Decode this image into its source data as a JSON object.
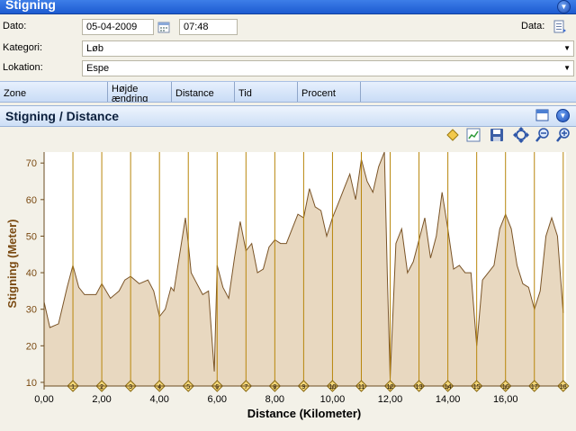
{
  "window": {
    "title": "Stigning"
  },
  "form": {
    "date_label": "Dato:",
    "date_value": "05-04-2009",
    "time_value": "07:48",
    "data_label": "Data:",
    "category_label": "Kategori:",
    "category_value": "Løb",
    "location_label": "Lokation:",
    "location_value": "Espe"
  },
  "grid": {
    "columns": [
      "Zone",
      "Højde ændring",
      "Distance",
      "Tid",
      "Procent"
    ]
  },
  "panel": {
    "title": "Stigning / Distance"
  },
  "icons": [
    "collapse-icon",
    "chevron-down-icon",
    "diamond-icon",
    "chart-icon",
    "save-icon",
    "fit-icon",
    "zoom-out-icon",
    "zoom-in-icon",
    "calendar-icon",
    "data-icon"
  ],
  "colors": {
    "area_fill": "#e8d8c0",
    "line": "#7a5427",
    "marker_line": "#b8860b",
    "axis_label": "#7a4a12"
  },
  "chart_data": {
    "type": "area",
    "xlabel": "Distance (Kilometer)",
    "ylabel": "Stigning (Meter)",
    "xlim": [
      0,
      18.1
    ],
    "ylim": [
      9,
      73
    ],
    "x_ticks": [
      "0,00",
      "2,00",
      "4,00",
      "6,00",
      "8,00",
      "10,00",
      "12,00",
      "14,00",
      "16,00"
    ],
    "x_tick_values": [
      0,
      2,
      4,
      6,
      8,
      10,
      12,
      14,
      16
    ],
    "y_ticks": [
      10,
      20,
      30,
      40,
      50,
      60,
      70
    ],
    "km_markers": [
      1,
      2,
      3,
      4,
      5,
      6,
      7,
      8,
      9,
      10,
      11,
      12,
      13,
      14,
      15,
      16,
      17,
      18
    ],
    "x": [
      0,
      0.2,
      0.5,
      0.8,
      1.0,
      1.2,
      1.4,
      1.6,
      1.8,
      2.0,
      2.3,
      2.6,
      2.8,
      3.0,
      3.3,
      3.6,
      3.8,
      4.0,
      4.2,
      4.4,
      4.5,
      4.7,
      4.9,
      5.0,
      5.1,
      5.3,
      5.5,
      5.7,
      5.8,
      5.9,
      6.0,
      6.2,
      6.4,
      6.6,
      6.8,
      7.0,
      7.2,
      7.4,
      7.6,
      7.8,
      8.0,
      8.2,
      8.4,
      8.6,
      8.8,
      9.0,
      9.2,
      9.4,
      9.6,
      9.8,
      10.0,
      10.2,
      10.4,
      10.6,
      10.8,
      11.0,
      11.2,
      11.4,
      11.6,
      11.8,
      11.9,
      12.0,
      12.2,
      12.4,
      12.6,
      12.8,
      13.0,
      13.2,
      13.4,
      13.6,
      13.8,
      14.0,
      14.2,
      14.4,
      14.6,
      14.8,
      15.0,
      15.2,
      15.4,
      15.6,
      15.8,
      16.0,
      16.2,
      16.4,
      16.6,
      16.8,
      17.0,
      17.2,
      17.4,
      17.6,
      17.8,
      18.0
    ],
    "y": [
      32,
      25,
      26,
      36,
      42,
      36,
      34,
      34,
      34,
      37,
      33,
      35,
      38,
      39,
      37,
      38,
      35,
      28,
      30,
      36,
      35,
      45,
      55,
      48,
      40,
      37,
      34,
      35,
      24,
      13,
      42,
      36,
      33,
      44,
      54,
      46,
      48,
      40,
      41,
      47,
      49,
      48,
      48,
      52,
      56,
      55,
      63,
      58,
      57,
      50,
      55,
      59,
      63,
      67,
      60,
      71,
      65,
      62,
      69,
      73,
      40,
      11,
      48,
      52,
      40,
      43,
      49,
      55,
      44,
      50,
      62,
      52,
      41,
      42,
      40,
      40,
      20,
      38,
      40,
      42,
      52,
      56,
      52,
      42,
      37,
      36,
      30,
      35,
      50,
      55,
      50,
      29
    ]
  }
}
